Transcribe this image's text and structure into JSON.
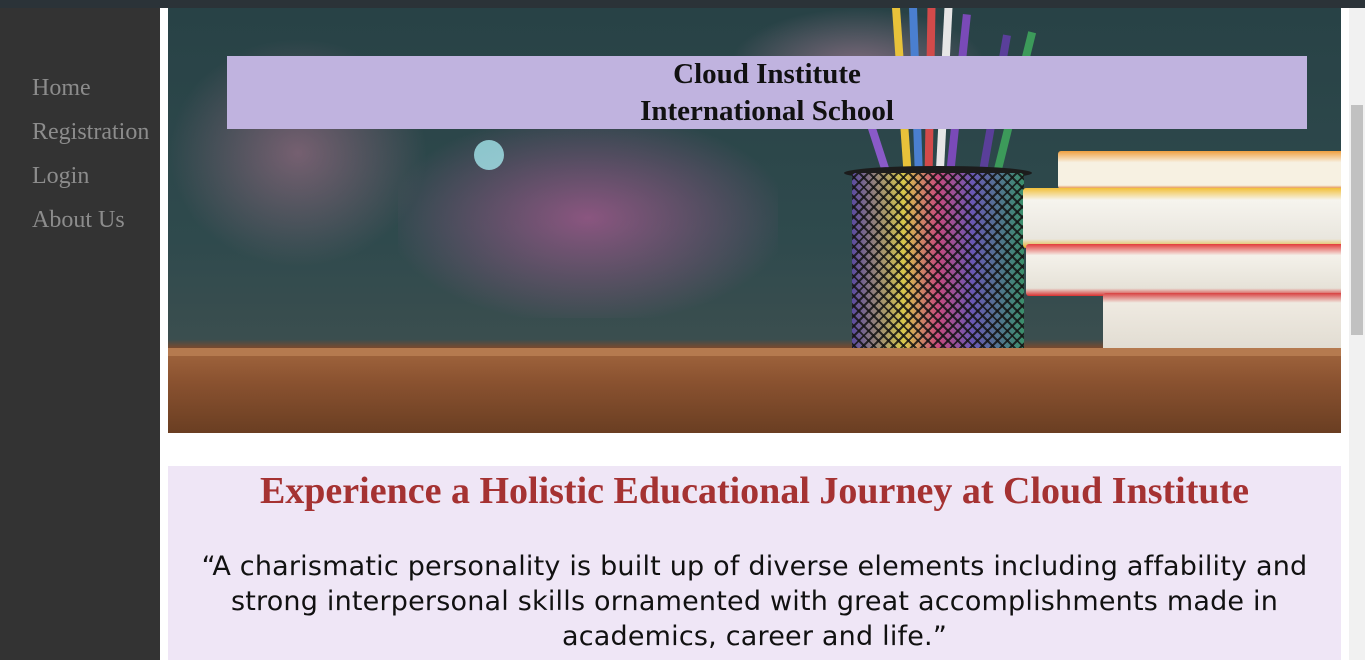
{
  "nav": {
    "items": [
      {
        "label": "Home"
      },
      {
        "label": "Registration"
      },
      {
        "label": "Login"
      },
      {
        "label": "About Us"
      }
    ]
  },
  "hero": {
    "title_line1": "Cloud Institute",
    "title_line2": "International School",
    "image": "classroom-desk-pencils-books"
  },
  "content": {
    "headline": "Experience a Holistic Educational Journey at Cloud Institute",
    "quote": "“A charismatic personality is built up of diverse elements including affability and strong interpersonal skills ornamented with great accomplishments made in academics, career and life.”"
  },
  "colors": {
    "sidebar_bg": "#333333",
    "nav_text": "#8c8c8c",
    "banner_bg": "#c0b3df",
    "headline": "#a53232",
    "content_bg": "#efe6f6"
  }
}
